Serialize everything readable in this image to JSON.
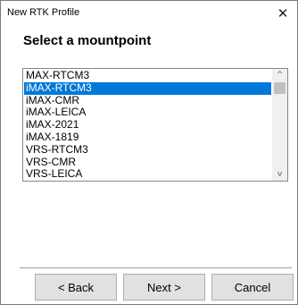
{
  "window": {
    "title": "New RTK Profile",
    "close_glyph": "✕"
  },
  "page": {
    "heading": "Select a mountpoint"
  },
  "mountpoints": {
    "items": [
      "MAX-RTCM3",
      "iMAX-RTCM3",
      "iMAX-CMR",
      "iMAX-LEICA",
      "iMAX-2021",
      "iMAX-1819",
      "VRS-RTCM3",
      "VRS-CMR",
      "VRS-LEICA"
    ],
    "selected_index": 1,
    "scroll_up_glyph": "^",
    "scroll_down_glyph": "v"
  },
  "buttons": {
    "back_label": "< Back",
    "next_label": "Next >",
    "cancel_label": "Cancel"
  },
  "colors": {
    "selection": "#0078d7",
    "button_face": "#e1e1e1"
  }
}
